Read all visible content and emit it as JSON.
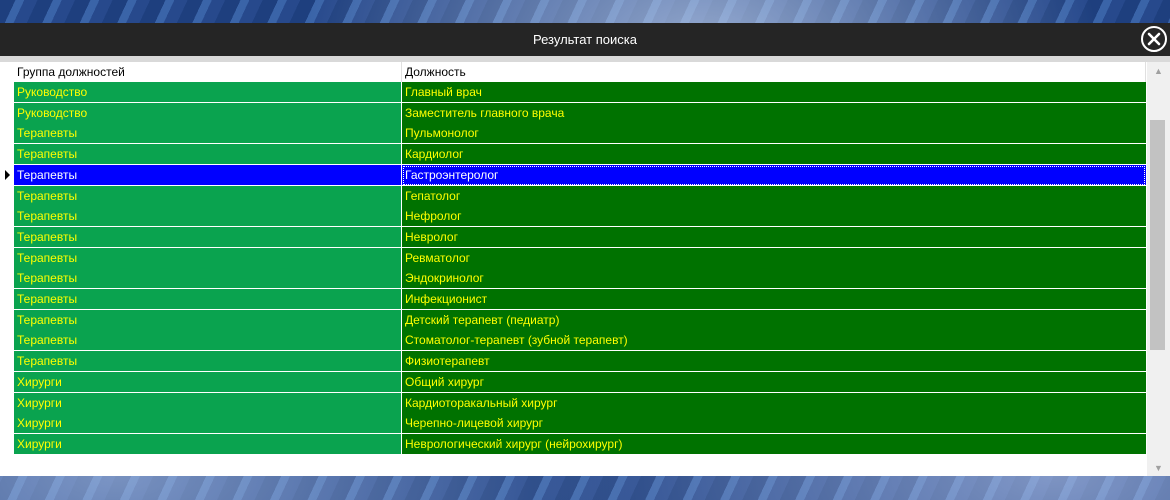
{
  "window": {
    "title": "Результат поиска",
    "close_icon": "close-circle-icon"
  },
  "grid": {
    "columns": [
      "Группа должностей",
      "Должность"
    ],
    "colors": {
      "group_cell_bg": "#0aa34f",
      "position_cell_bg": "#007200",
      "text": "#ffff00",
      "selected_bg": "#0000ff",
      "selected_text": "#ffffff"
    },
    "selected_index": 4,
    "rows": [
      {
        "group": "Руководство",
        "position": "Главный врач"
      },
      {
        "group": "Руководство",
        "position": "Заместитель главного врача"
      },
      {
        "group": "Терапевты",
        "position": "Пульмонолог"
      },
      {
        "group": "Терапевты",
        "position": "Кардиолог"
      },
      {
        "group": "Терапевты",
        "position": "Гастроэнтеролог"
      },
      {
        "group": "Терапевты",
        "position": "Гепатолог"
      },
      {
        "group": "Терапевты",
        "position": "Нефролог"
      },
      {
        "group": "Терапевты",
        "position": "Невролог"
      },
      {
        "group": "Терапевты",
        "position": "Ревматолог"
      },
      {
        "group": "Терапевты",
        "position": "Эндокринолог"
      },
      {
        "group": "Терапевты",
        "position": "Инфекционист"
      },
      {
        "group": "Терапевты",
        "position": "Детский терапевт (педиатр)"
      },
      {
        "group": "Терапевты",
        "position": "Стоматолог-терапевт (зубной терапевт)"
      },
      {
        "group": "Терапевты",
        "position": "Физиотерапевт"
      },
      {
        "group": "Хирурги",
        "position": "Общий хирург"
      },
      {
        "group": "Хирурги",
        "position": "Кардиоторакальный хирург"
      },
      {
        "group": "Хирурги",
        "position": "Черепно-лицевой хирург"
      },
      {
        "group": "Хирурги",
        "position": "Неврологический хирург (нейрохирург)"
      }
    ]
  },
  "scrollbar": {
    "up_icon": "scroll-up-arrow-icon",
    "down_icon": "scroll-down-arrow-icon"
  }
}
